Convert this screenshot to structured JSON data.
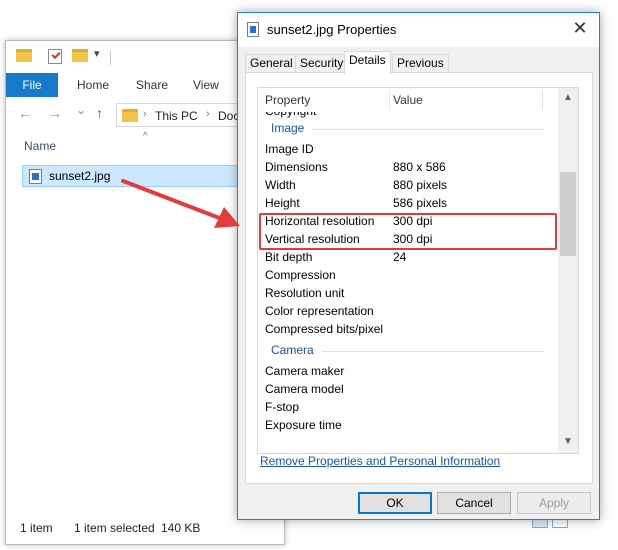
{
  "explorer": {
    "ribbon_tabs": [
      "File",
      "Home",
      "Share",
      "View"
    ],
    "nav": {
      "back": "←",
      "forward": "→",
      "dropdown": "⌄",
      "up": "↑"
    },
    "address": {
      "crumb1": "This PC",
      "crumb2": "Doc",
      "separator": "›"
    },
    "sort_caret": "^",
    "column_name": "Name",
    "selected_file": "sunset2.jpg",
    "status": {
      "count": "1 item",
      "selected": "1 item selected",
      "size": "140 KB"
    },
    "qat_dropdown": "▾"
  },
  "dialog": {
    "title": "sunset2.jpg Properties",
    "close": "✕",
    "tabs": [
      "General",
      "Security",
      "Details",
      "Previous Versions"
    ],
    "active_tab": "Details",
    "columns": {
      "property": "Property",
      "value": "Value"
    },
    "partial_row": "Copyright",
    "group_image": "Image",
    "image_rows": [
      {
        "property": "Image ID",
        "value": ""
      },
      {
        "property": "Dimensions",
        "value": "880 x 586"
      },
      {
        "property": "Width",
        "value": "880 pixels"
      },
      {
        "property": "Height",
        "value": "586 pixels"
      },
      {
        "property": "Horizontal resolution",
        "value": "300 dpi"
      },
      {
        "property": "Vertical resolution",
        "value": "300 dpi"
      },
      {
        "property": "Bit depth",
        "value": "24"
      },
      {
        "property": "Compression",
        "value": ""
      },
      {
        "property": "Resolution unit",
        "value": ""
      },
      {
        "property": "Color representation",
        "value": ""
      },
      {
        "property": "Compressed bits/pixel",
        "value": ""
      }
    ],
    "group_camera": "Camera",
    "camera_rows": [
      {
        "property": "Camera maker",
        "value": ""
      },
      {
        "property": "Camera model",
        "value": ""
      },
      {
        "property": "F-stop",
        "value": ""
      },
      {
        "property": "Exposure time",
        "value": ""
      }
    ],
    "scroll_up": "▲",
    "scroll_down": "▼",
    "remove_link": "Remove Properties and Personal Information",
    "buttons": {
      "ok": "OK",
      "cancel": "Cancel",
      "apply": "Apply"
    }
  },
  "colors": {
    "accent": "#1979ca",
    "selection": "#cce8ff",
    "highlight": "#e53a3a",
    "group_text": "#1f4ea3",
    "link": "#1a55b0"
  },
  "icons": [
    "folder-icon",
    "properties-icon",
    "new-folder-icon",
    "image-file-icon",
    "close-icon",
    "arrow-annotation"
  ]
}
